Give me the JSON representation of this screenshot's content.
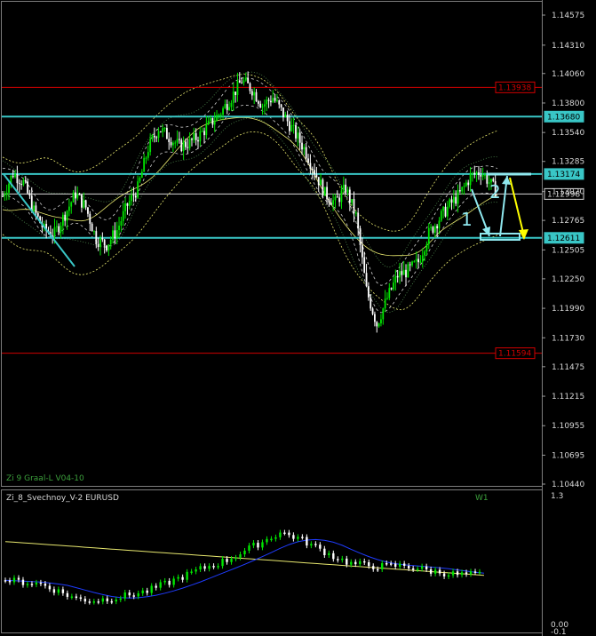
{
  "colors": {
    "background": "#000000",
    "frame": "#7c7c7c",
    "bull_candle": "#00e600",
    "bear_candle": "#ffffff",
    "resistance_line": "#d10000",
    "cyan_line": "#39c6c6",
    "arrow_cyan": "#8fe8ef",
    "arrow_yellow": "#ffff00",
    "band_yellow": "#e6e66e",
    "band_green": "#4f8c4f",
    "band_white": "#d0d0d0",
    "indicator_blue": "#1f3cff",
    "indicator_yellow": "#e6e66e",
    "label_green": "#3ca03c"
  },
  "main_panel": {
    "indicator_label": "Zi 9 Graal-L V04-10"
  },
  "sub_panel": {
    "indicator_label": "Zi_8_Svechnoy_V-2 EURUSD",
    "timeframe_label": "W1",
    "scale_top": "1.3",
    "scale_bottom": "0.00",
    "scale_bottom2": "-0.1"
  },
  "annotations": {
    "wave1": "1",
    "wave2": "2"
  },
  "chart_data": [
    {
      "type": "candlestick",
      "title": "",
      "ylim": [
        1.1443,
        1.1469
      ],
      "y_ticks": [
        "1.14575",
        "1.14310",
        "1.14060",
        "1.13800",
        "1.13540",
        "1.13285",
        "1.13020",
        "1.12765",
        "1.12505",
        "1.12250",
        "1.11990",
        "1.11730",
        "1.11475",
        "1.11215",
        "1.10955",
        "1.10695",
        "1.10440"
      ],
      "y_tick_values": [
        1.14575,
        1.1431,
        1.1406,
        1.138,
        1.1354,
        1.13285,
        1.1302,
        1.12765,
        1.12505,
        1.1225,
        1.1199,
        1.1173,
        1.11475,
        1.11215,
        1.10955,
        1.10695,
        1.1044
      ],
      "price_levels": [
        {
          "name": "resistance",
          "value": 1.13938,
          "label": "1.13938",
          "style": "red"
        },
        {
          "name": "cyan-top",
          "value": 1.1368,
          "label": "1.13680",
          "style": "cyan"
        },
        {
          "name": "cyan-mid",
          "value": 1.13174,
          "label": "1.13174",
          "style": "cyan"
        },
        {
          "name": "current",
          "value": 1.12998,
          "label": "1.12998",
          "style": "white"
        },
        {
          "name": "cyan-low",
          "value": 1.12611,
          "label": "1.12611",
          "style": "cyan"
        },
        {
          "name": "support",
          "value": 1.11594,
          "label": "1.11594",
          "style": "red"
        }
      ],
      "close_path": [
        [
          0,
          1.1298
        ],
        [
          5,
          1.1318
        ],
        [
          10,
          1.131
        ],
        [
          15,
          1.1285
        ],
        [
          20,
          1.1268
        ],
        [
          25,
          1.1265
        ],
        [
          30,
          1.1282
        ],
        [
          35,
          1.13
        ],
        [
          40,
          1.1288
        ],
        [
          45,
          1.126
        ],
        [
          50,
          1.1255
        ],
        [
          55,
          1.1268
        ],
        [
          60,
          1.129
        ],
        [
          65,
          1.1305
        ],
        [
          70,
          1.134
        ],
        [
          75,
          1.1358
        ],
        [
          80,
          1.135
        ],
        [
          85,
          1.1342
        ],
        [
          90,
          1.1345
        ],
        [
          95,
          1.1352
        ],
        [
          100,
          1.1362
        ],
        [
          105,
          1.1372
        ],
        [
          110,
          1.1385
        ],
        [
          115,
          1.14
        ],
        [
          120,
          1.1392
        ],
        [
          125,
          1.1378
        ],
        [
          130,
          1.1385
        ],
        [
          135,
          1.137
        ],
        [
          140,
          1.1355
        ],
        [
          145,
          1.134
        ],
        [
          150,
          1.132
        ],
        [
          155,
          1.13
        ],
        [
          160,
          1.1292
        ],
        [
          165,
          1.1305
        ],
        [
          170,
          1.128
        ],
        [
          175,
          1.1215
        ],
        [
          180,
          1.1185
        ],
        [
          185,
          1.1208
        ],
        [
          190,
          1.1228
        ],
        [
          195,
          1.1232
        ],
        [
          200,
          1.124
        ],
        [
          205,
          1.1265
        ],
        [
          210,
          1.1278
        ],
        [
          215,
          1.129
        ],
        [
          220,
          1.13
        ],
        [
          225,
          1.1315
        ],
        [
          230,
          1.132
        ],
        [
          235,
          1.1308
        ],
        [
          238,
          1.13
        ]
      ]
    },
    {
      "type": "line",
      "title": "",
      "ylim": [
        -0.1,
        1.3
      ],
      "series": [
        {
          "values_path": "candles-oscillator"
        },
        {
          "values_path": "blue-signal"
        },
        {
          "values_path": "yellow-signal"
        }
      ]
    }
  ]
}
